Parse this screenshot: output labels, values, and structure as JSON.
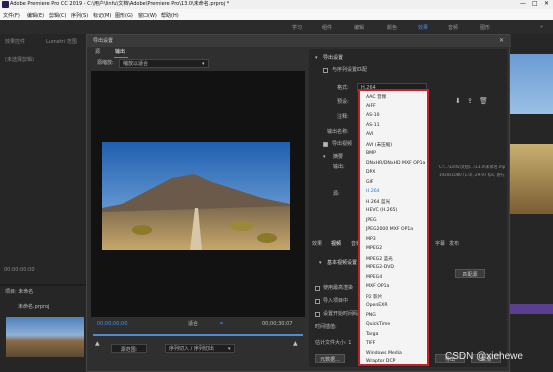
{
  "window_title": "Adobe Premiere Pro CC 2019 - C:\\用户\\linfu\\文档\\Adobe\\Premiere Pro\\13.0\\未命名.prproj *",
  "menus": [
    "文件(F)",
    "编辑(E)",
    "剪辑(C)",
    "序列(S)",
    "标记(M)",
    "图形(G)",
    "窗口(W)",
    "帮助(H)"
  ],
  "workspaces": [
    "学习",
    "组件",
    "编辑",
    "颜色",
    "效果",
    "音频",
    "图形"
  ],
  "left_panel": {
    "tabs": [
      "效果控件",
      "Lumetri 范围"
    ],
    "placeholder": "(未选择剪辑)",
    "project_label": "项目: 未命名",
    "project_file": "未命名.prproj",
    "timecode": "00:00:00:00"
  },
  "dialog": {
    "title": "导出设置",
    "source_tabs": [
      "源",
      "输出"
    ],
    "scaling_label": "源缩放:",
    "scaling_value": "缩放以适合",
    "timecode_start": "00;00;00;00",
    "timecode_end": "00;00;30;07",
    "fit_label": "适合",
    "source_range_label": "源范围:",
    "source_range_value": "序列切入 / 序列切出",
    "export_settings_header": "导出设置",
    "match_sequence_label": "与序列设置匹配",
    "format_label": "格式:",
    "format_value": "H.264",
    "preset_label": "预设:",
    "comment_label": "注释:",
    "output_name_label": "输出名称:",
    "export_video_label": "导出视频",
    "summary_label": "摘要",
    "output_label": "输出:",
    "output_path": "C:\\...\\Linfu\\文档\\...\\13.0\\未命名.mp4",
    "output_detail": "1920x1080 (1.0), 29.97 fps, 逐行, 00:00:30:07",
    "source_label": "源:",
    "tabs_bottom": [
      "效果",
      "视频",
      "音频",
      "多路复用器",
      "字幕",
      "发布"
    ],
    "basic_video_label": "基本视频设置",
    "max_depth_label": "使用最高渲染",
    "import_project_label": "导入项目中",
    "set_start_tc_label": "设置开始时间码",
    "interp_label": "时间插值:",
    "file_size_label": "估计文件大小: 1",
    "metadata_button": "元数据...",
    "queue_button": "队列",
    "export_button": "导出",
    "cancel_button": "取消",
    "match_source_button": "匹配源",
    "format_options": [
      "AAC 音频",
      "AIFF",
      "AS-10",
      "AS-11",
      "AVI",
      "AVI (未压缩)",
      "BMP",
      "DNxHR/DNxHD MXF OP1a",
      "DPX",
      "GIF",
      "H.264",
      "H.264 蓝光",
      "HEVC (H.265)",
      "JPEG",
      "JPEG2000 MXF OP1a",
      "MP3",
      "MPEG2",
      "MPEG2 蓝光",
      "MPEG2-DVD",
      "MPEG4",
      "MXF OP1a",
      "P2 影片",
      "OpenEXR",
      "PNG",
      "QuickTime",
      "Targa",
      "TIFF",
      "Windows Media",
      "Wraptor DCP"
    ],
    "selected_format": "H.264"
  },
  "watermark": "CSDN @xiehewe"
}
